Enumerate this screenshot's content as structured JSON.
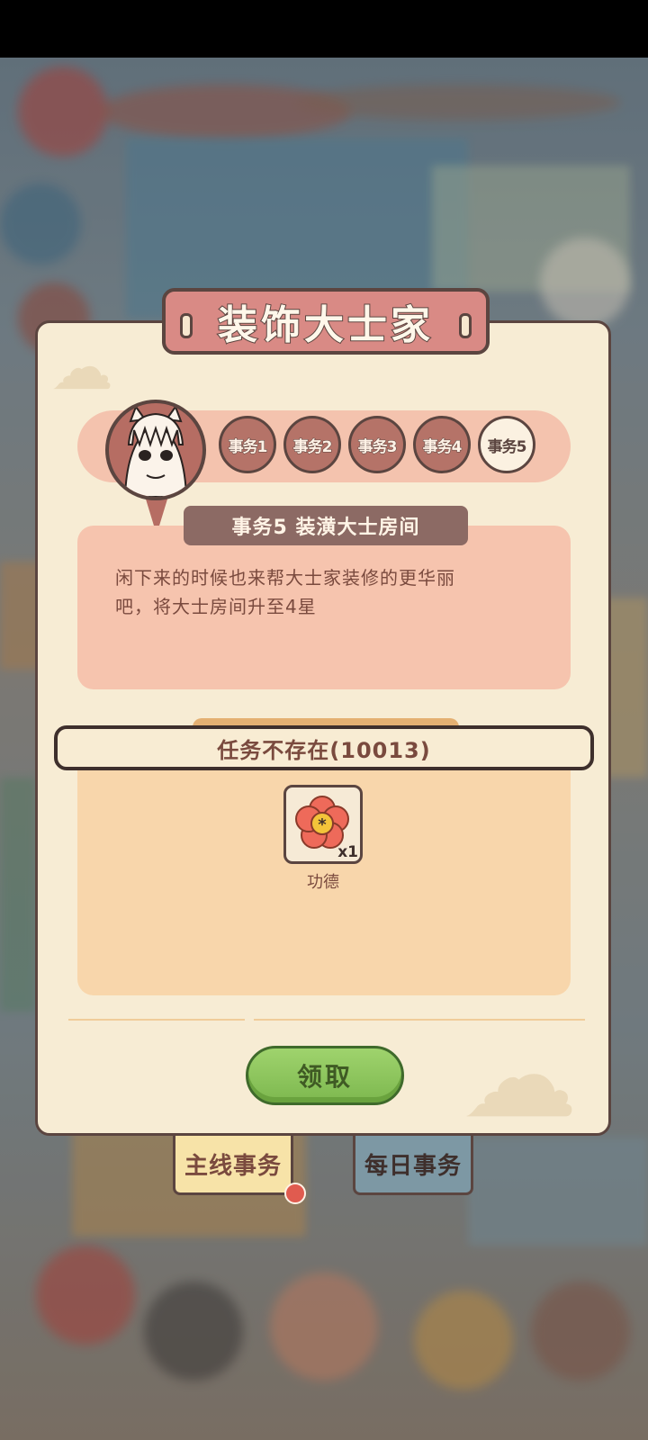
{
  "title": "装饰大士家",
  "steps": [
    {
      "label": "事务1",
      "active": false
    },
    {
      "label": "事务2",
      "active": false
    },
    {
      "label": "事务3",
      "active": false
    },
    {
      "label": "事务4",
      "active": false
    },
    {
      "label": "事务5",
      "active": true
    }
  ],
  "task": {
    "label": "事务5  装潢大士房间",
    "description_line1": "闲下来的时候也来帮大士家装修的更华丽",
    "description_line2": "吧，将大士房间升至4星"
  },
  "toast": "任务不存在(10013)",
  "reward": {
    "icon": "flower-icon",
    "quantity": "x1",
    "name": "功德"
  },
  "claim_button": "领取",
  "bottom_tabs": {
    "main": "主线事务",
    "daily": "每日事务"
  },
  "colors": {
    "panel": "#f7ecd4",
    "title_banner": "#d98a85",
    "claim_green": "#8cc65c",
    "notification_red": "#e05b4f"
  }
}
